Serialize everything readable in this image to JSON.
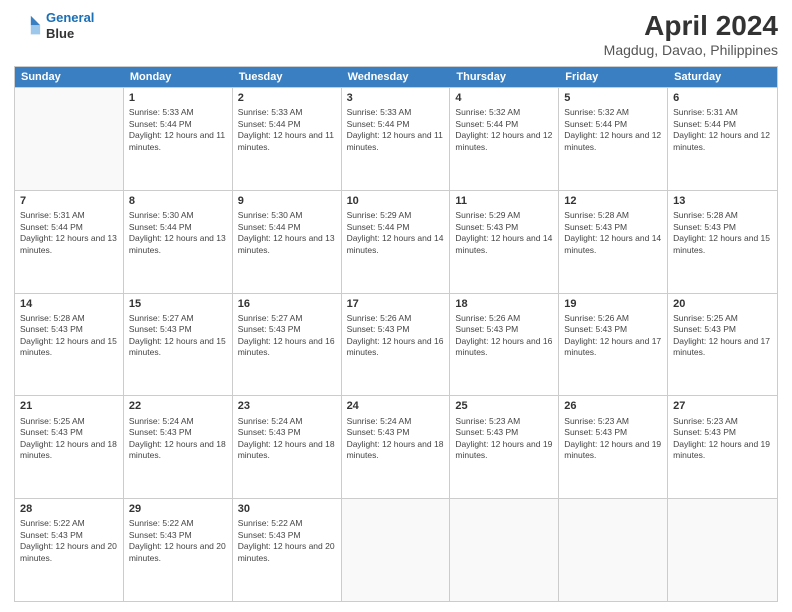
{
  "header": {
    "logo_line1": "General",
    "logo_line2": "Blue",
    "month_title": "April 2024",
    "location": "Magdug, Davao, Philippines"
  },
  "days_of_week": [
    "Sunday",
    "Monday",
    "Tuesday",
    "Wednesday",
    "Thursday",
    "Friday",
    "Saturday"
  ],
  "weeks": [
    [
      {
        "day": "",
        "sunrise": "",
        "sunset": "",
        "daylight": ""
      },
      {
        "day": "1",
        "sunrise": "Sunrise: 5:33 AM",
        "sunset": "Sunset: 5:44 PM",
        "daylight": "Daylight: 12 hours and 11 minutes."
      },
      {
        "day": "2",
        "sunrise": "Sunrise: 5:33 AM",
        "sunset": "Sunset: 5:44 PM",
        "daylight": "Daylight: 12 hours and 11 minutes."
      },
      {
        "day": "3",
        "sunrise": "Sunrise: 5:33 AM",
        "sunset": "Sunset: 5:44 PM",
        "daylight": "Daylight: 12 hours and 11 minutes."
      },
      {
        "day": "4",
        "sunrise": "Sunrise: 5:32 AM",
        "sunset": "Sunset: 5:44 PM",
        "daylight": "Daylight: 12 hours and 12 minutes."
      },
      {
        "day": "5",
        "sunrise": "Sunrise: 5:32 AM",
        "sunset": "Sunset: 5:44 PM",
        "daylight": "Daylight: 12 hours and 12 minutes."
      },
      {
        "day": "6",
        "sunrise": "Sunrise: 5:31 AM",
        "sunset": "Sunset: 5:44 PM",
        "daylight": "Daylight: 12 hours and 12 minutes."
      }
    ],
    [
      {
        "day": "7",
        "sunrise": "Sunrise: 5:31 AM",
        "sunset": "Sunset: 5:44 PM",
        "daylight": "Daylight: 12 hours and 13 minutes."
      },
      {
        "day": "8",
        "sunrise": "Sunrise: 5:30 AM",
        "sunset": "Sunset: 5:44 PM",
        "daylight": "Daylight: 12 hours and 13 minutes."
      },
      {
        "day": "9",
        "sunrise": "Sunrise: 5:30 AM",
        "sunset": "Sunset: 5:44 PM",
        "daylight": "Daylight: 12 hours and 13 minutes."
      },
      {
        "day": "10",
        "sunrise": "Sunrise: 5:29 AM",
        "sunset": "Sunset: 5:44 PM",
        "daylight": "Daylight: 12 hours and 14 minutes."
      },
      {
        "day": "11",
        "sunrise": "Sunrise: 5:29 AM",
        "sunset": "Sunset: 5:43 PM",
        "daylight": "Daylight: 12 hours and 14 minutes."
      },
      {
        "day": "12",
        "sunrise": "Sunrise: 5:28 AM",
        "sunset": "Sunset: 5:43 PM",
        "daylight": "Daylight: 12 hours and 14 minutes."
      },
      {
        "day": "13",
        "sunrise": "Sunrise: 5:28 AM",
        "sunset": "Sunset: 5:43 PM",
        "daylight": "Daylight: 12 hours and 15 minutes."
      }
    ],
    [
      {
        "day": "14",
        "sunrise": "Sunrise: 5:28 AM",
        "sunset": "Sunset: 5:43 PM",
        "daylight": "Daylight: 12 hours and 15 minutes."
      },
      {
        "day": "15",
        "sunrise": "Sunrise: 5:27 AM",
        "sunset": "Sunset: 5:43 PM",
        "daylight": "Daylight: 12 hours and 15 minutes."
      },
      {
        "day": "16",
        "sunrise": "Sunrise: 5:27 AM",
        "sunset": "Sunset: 5:43 PM",
        "daylight": "Daylight: 12 hours and 16 minutes."
      },
      {
        "day": "17",
        "sunrise": "Sunrise: 5:26 AM",
        "sunset": "Sunset: 5:43 PM",
        "daylight": "Daylight: 12 hours and 16 minutes."
      },
      {
        "day": "18",
        "sunrise": "Sunrise: 5:26 AM",
        "sunset": "Sunset: 5:43 PM",
        "daylight": "Daylight: 12 hours and 16 minutes."
      },
      {
        "day": "19",
        "sunrise": "Sunrise: 5:26 AM",
        "sunset": "Sunset: 5:43 PM",
        "daylight": "Daylight: 12 hours and 17 minutes."
      },
      {
        "day": "20",
        "sunrise": "Sunrise: 5:25 AM",
        "sunset": "Sunset: 5:43 PM",
        "daylight": "Daylight: 12 hours and 17 minutes."
      }
    ],
    [
      {
        "day": "21",
        "sunrise": "Sunrise: 5:25 AM",
        "sunset": "Sunset: 5:43 PM",
        "daylight": "Daylight: 12 hours and 18 minutes."
      },
      {
        "day": "22",
        "sunrise": "Sunrise: 5:24 AM",
        "sunset": "Sunset: 5:43 PM",
        "daylight": "Daylight: 12 hours and 18 minutes."
      },
      {
        "day": "23",
        "sunrise": "Sunrise: 5:24 AM",
        "sunset": "Sunset: 5:43 PM",
        "daylight": "Daylight: 12 hours and 18 minutes."
      },
      {
        "day": "24",
        "sunrise": "Sunrise: 5:24 AM",
        "sunset": "Sunset: 5:43 PM",
        "daylight": "Daylight: 12 hours and 18 minutes."
      },
      {
        "day": "25",
        "sunrise": "Sunrise: 5:23 AM",
        "sunset": "Sunset: 5:43 PM",
        "daylight": "Daylight: 12 hours and 19 minutes."
      },
      {
        "day": "26",
        "sunrise": "Sunrise: 5:23 AM",
        "sunset": "Sunset: 5:43 PM",
        "daylight": "Daylight: 12 hours and 19 minutes."
      },
      {
        "day": "27",
        "sunrise": "Sunrise: 5:23 AM",
        "sunset": "Sunset: 5:43 PM",
        "daylight": "Daylight: 12 hours and 19 minutes."
      }
    ],
    [
      {
        "day": "28",
        "sunrise": "Sunrise: 5:22 AM",
        "sunset": "Sunset: 5:43 PM",
        "daylight": "Daylight: 12 hours and 20 minutes."
      },
      {
        "day": "29",
        "sunrise": "Sunrise: 5:22 AM",
        "sunset": "Sunset: 5:43 PM",
        "daylight": "Daylight: 12 hours and 20 minutes."
      },
      {
        "day": "30",
        "sunrise": "Sunrise: 5:22 AM",
        "sunset": "Sunset: 5:43 PM",
        "daylight": "Daylight: 12 hours and 20 minutes."
      },
      {
        "day": "",
        "sunrise": "",
        "sunset": "",
        "daylight": ""
      },
      {
        "day": "",
        "sunrise": "",
        "sunset": "",
        "daylight": ""
      },
      {
        "day": "",
        "sunrise": "",
        "sunset": "",
        "daylight": ""
      },
      {
        "day": "",
        "sunrise": "",
        "sunset": "",
        "daylight": ""
      }
    ]
  ]
}
